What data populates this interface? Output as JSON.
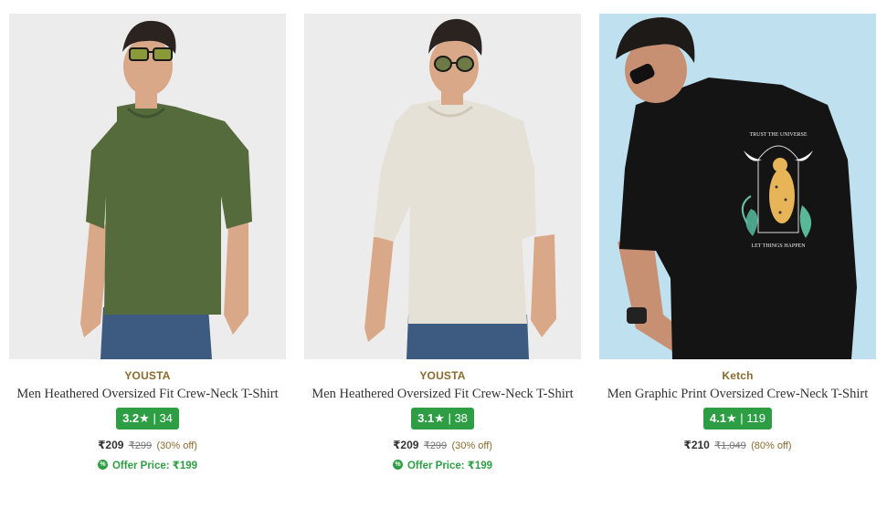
{
  "products": [
    {
      "image_label": "Men Heathered Oversized Fit Crew-Neck T-Shirt (olive)",
      "brand": "YOUSTA",
      "name": "Men Heathered Oversized Fit Crew-Neck T-Shirt",
      "rating": "3.2",
      "star": "★",
      "separator": "|",
      "reviews": "34",
      "price": "₹209",
      "mrp": "₹299",
      "discount": "(30% off)",
      "offer_icon": "%",
      "offer_text": "Offer Price: ₹199",
      "shirt_color": "#556b3c"
    },
    {
      "image_label": "Men Heathered Oversized Fit Crew-Neck T-Shirt (cream)",
      "brand": "YOUSTA",
      "name": "Men Heathered Oversized Fit Crew-Neck T-Shirt",
      "rating": "3.1",
      "star": "★",
      "separator": "|",
      "reviews": "38",
      "price": "₹209",
      "mrp": "₹299",
      "discount": "(30% off)",
      "offer_icon": "%",
      "offer_text": "Offer Price: ₹199",
      "shirt_color": "#e6e1d6"
    },
    {
      "image_label": "Men Graphic Print Oversized Crew-Neck T-Shirt (black)",
      "brand": "Ketch",
      "name": "Men Graphic Print Oversized Crew-Neck T-Shirt",
      "rating": "4.1",
      "star": "★",
      "separator": "|",
      "reviews": "119",
      "price": "₹210",
      "mrp": "₹1,049",
      "discount": "(80% off)",
      "shirt_color": "#141414",
      "print_top": "TRUST THE UNIVERSE",
      "print_bottom": "LET THINGS HAPPEN"
    }
  ],
  "colors": {
    "brand_text": "#8b6a2e",
    "rating_bg": "#2e9e44",
    "offer_green": "#2e9e44",
    "image_bg_light": "#ececec",
    "image_bg_blue": "#bfe0ef"
  }
}
